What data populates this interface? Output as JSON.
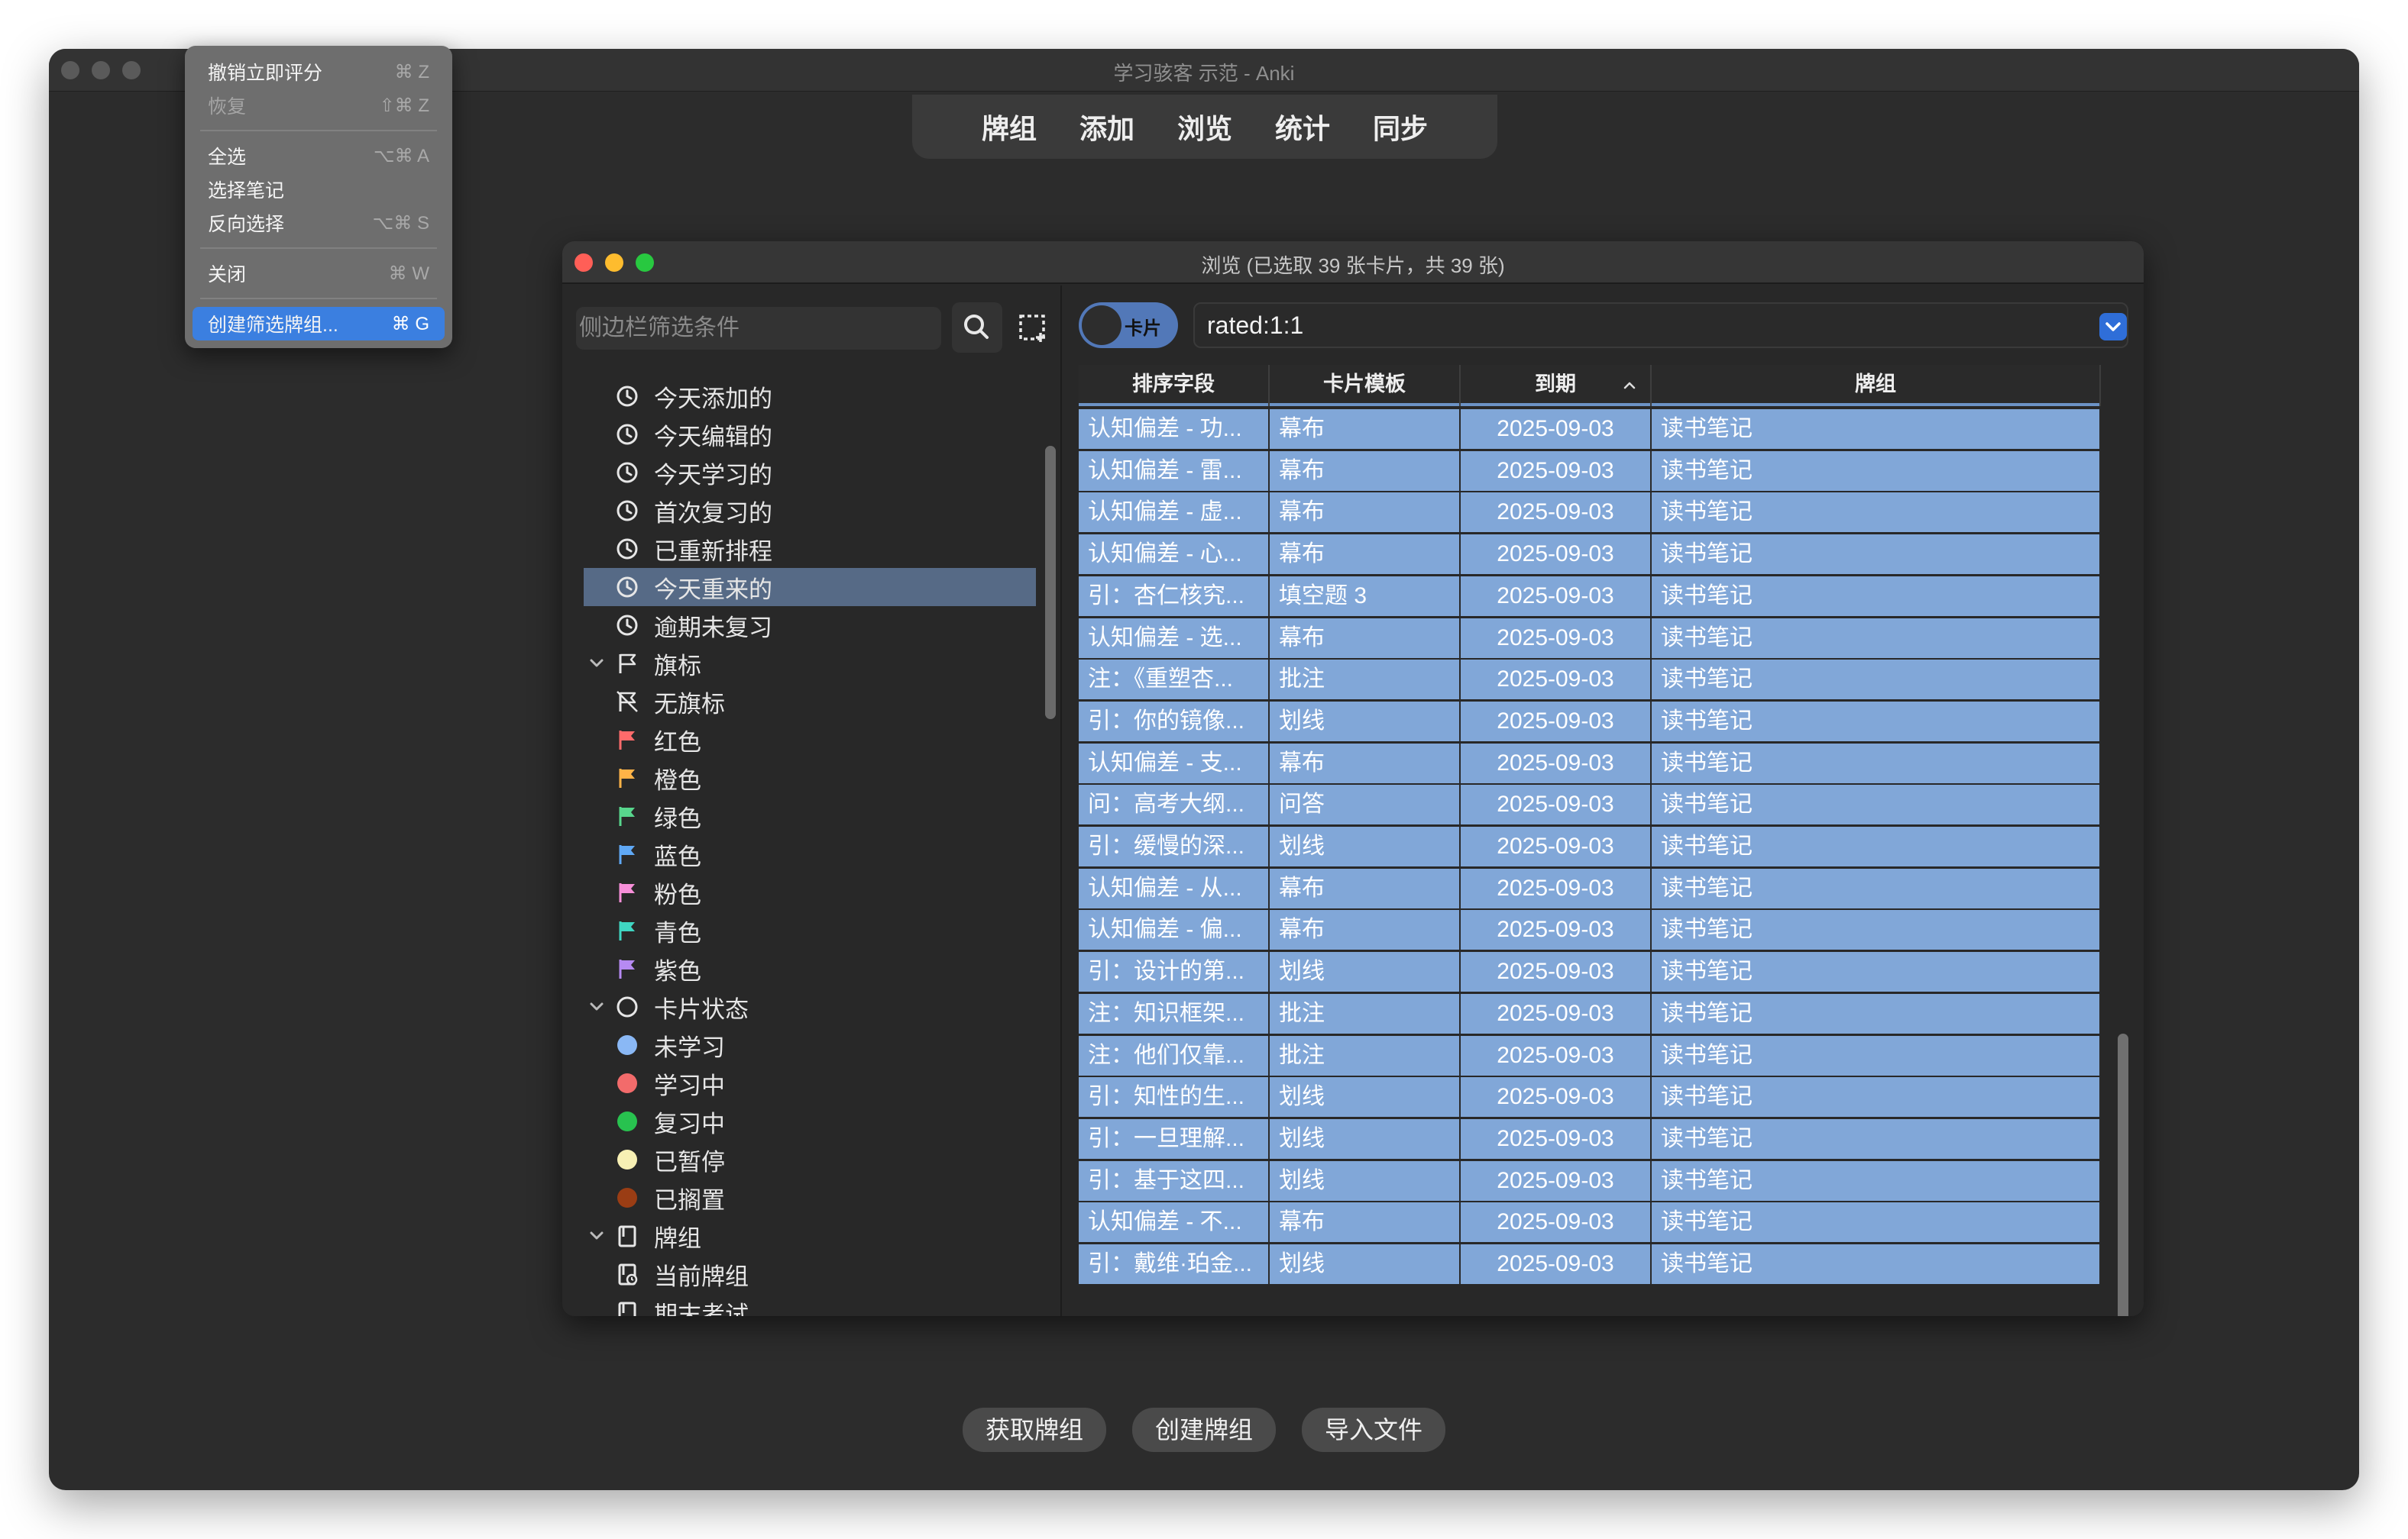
{
  "window": {
    "title": "学习骇客 示范 - Anki"
  },
  "toolbar": {
    "decks": "牌组",
    "add": "添加",
    "browse": "浏览",
    "stats": "统计",
    "sync": "同步"
  },
  "bottom_buttons": {
    "get_shared": "获取牌组",
    "create_deck": "创建牌组",
    "import_file": "导入文件"
  },
  "browser": {
    "title": "浏览 (已选取 39 张卡片，共 39 张)",
    "sidebar_search_placeholder": "侧边栏筛选条件",
    "toggle_label": "卡片",
    "search_query": "rated:1:1",
    "sidebar": {
      "today_items": [
        "今天添加的",
        "今天编辑的",
        "今天学习的",
        "首次复习的",
        "已重新排程",
        "今天重来的",
        "逾期未复习"
      ],
      "flags_header": "旗标",
      "flags": [
        {
          "label": "无旗标",
          "color": "#dddddd"
        },
        {
          "label": "红色",
          "color": "#ff6b6b"
        },
        {
          "label": "橙色",
          "color": "#ffb347"
        },
        {
          "label": "绿色",
          "color": "#58d68d"
        },
        {
          "label": "蓝色",
          "color": "#5fa8f5"
        },
        {
          "label": "粉色",
          "color": "#f78fd9"
        },
        {
          "label": "青色",
          "color": "#3fd6c2"
        },
        {
          "label": "紫色",
          "color": "#b68af2"
        }
      ],
      "state_header": "卡片状态",
      "states": [
        {
          "label": "未学习",
          "color": "#8ab8f5"
        },
        {
          "label": "学习中",
          "color": "#f26b6b"
        },
        {
          "label": "复习中",
          "color": "#28c24f"
        },
        {
          "label": "已暂停",
          "color": "#f7f0b4"
        },
        {
          "label": "已搁置",
          "color": "#9a3d14"
        }
      ],
      "decks_header": "牌组",
      "decks": [
        "当前牌组",
        "期末考试"
      ]
    },
    "columns": [
      "排序字段",
      "卡片模板",
      "到期",
      "牌组"
    ],
    "rows": [
      [
        "认知偏差 - 功...",
        "幕布",
        "2025-09-03",
        "读书笔记"
      ],
      [
        "认知偏差 - 雷...",
        "幕布",
        "2025-09-03",
        "读书笔记"
      ],
      [
        "认知偏差 - 虚...",
        "幕布",
        "2025-09-03",
        "读书笔记"
      ],
      [
        "认知偏差 - 心...",
        "幕布",
        "2025-09-03",
        "读书笔记"
      ],
      [
        "引：杏仁核究...",
        "填空题 3",
        "2025-09-03",
        "读书笔记"
      ],
      [
        "认知偏差 - 选...",
        "幕布",
        "2025-09-03",
        "读书笔记"
      ],
      [
        "注：《重塑杏...",
        "批注",
        "2025-09-03",
        "读书笔记"
      ],
      [
        "引：你的镜像...",
        "划线",
        "2025-09-03",
        "读书笔记"
      ],
      [
        "认知偏差 - 支...",
        "幕布",
        "2025-09-03",
        "读书笔记"
      ],
      [
        "问：高考大纲...",
        "问答",
        "2025-09-03",
        "读书笔记"
      ],
      [
        "引：缓慢的深...",
        "划线",
        "2025-09-03",
        "读书笔记"
      ],
      [
        "认知偏差 - 从...",
        "幕布",
        "2025-09-03",
        "读书笔记"
      ],
      [
        "认知偏差 - 偏...",
        "幕布",
        "2025-09-03",
        "读书笔记"
      ],
      [
        "引：设计的第...",
        "划线",
        "2025-09-03",
        "读书笔记"
      ],
      [
        "注：知识框架...",
        "批注",
        "2025-09-03",
        "读书笔记"
      ],
      [
        "注：他们仅靠...",
        "批注",
        "2025-09-03",
        "读书笔记"
      ],
      [
        "引：知性的生...",
        "划线",
        "2025-09-03",
        "读书笔记"
      ],
      [
        "引：一旦理解...",
        "划线",
        "2025-09-03",
        "读书笔记"
      ],
      [
        "引：基于这四...",
        "划线",
        "2025-09-03",
        "读书笔记"
      ],
      [
        "认知偏差 - 不...",
        "幕布",
        "2025-09-03",
        "读书笔记"
      ],
      [
        "引：戴维·珀金...",
        "划线",
        "2025-09-03",
        "读书笔记"
      ]
    ]
  },
  "edit_menu": {
    "items": [
      {
        "label": "撤销立即评分",
        "shortcut": "⌘ Z",
        "disabled": false
      },
      {
        "label": "恢复",
        "shortcut": "⇧⌘ Z",
        "disabled": true
      },
      {
        "label": "全选",
        "shortcut": "⌥⌘ A",
        "disabled": false
      },
      {
        "label": "选择笔记",
        "shortcut": "",
        "disabled": false
      },
      {
        "label": "反向选择",
        "shortcut": "⌥⌘ S",
        "disabled": false
      },
      {
        "label": "关闭",
        "shortcut": "⌘ W",
        "disabled": false
      },
      {
        "label": "创建筛选牌组...",
        "shortcut": "⌘ G",
        "disabled": false
      }
    ]
  },
  "colors": {
    "accent": "#3b7fe0",
    "row_selected": "#81a7d8",
    "sidebar_selected": "#566a86"
  }
}
